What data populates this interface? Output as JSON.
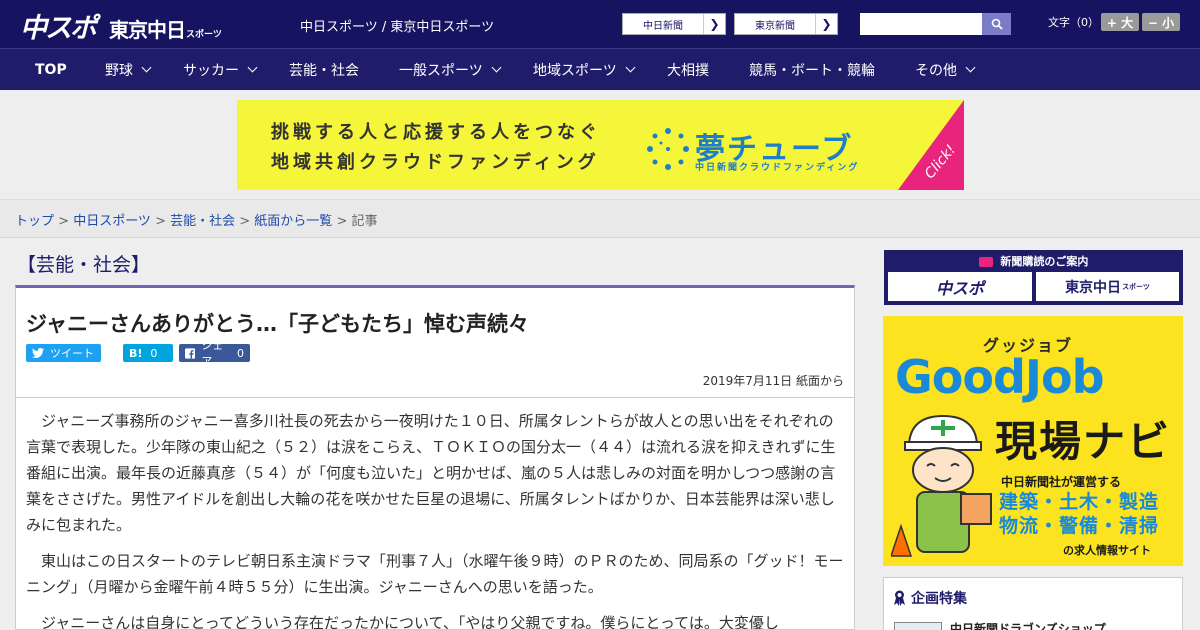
{
  "header": {
    "logo_main": "中スポ",
    "logo_tokyo": "東京中日",
    "logo_tokyo_small": "スポーツ",
    "sites_text": "中日スポーツ / 東京中日スポーツ",
    "site_buttons": [
      {
        "label": "中日新聞"
      },
      {
        "label": "東京新聞"
      }
    ],
    "search_placeholder": "",
    "font_label": "文字（0）",
    "font_plus": "+ 大",
    "font_minus": "− 小"
  },
  "nav": {
    "items": [
      {
        "label": "TOP"
      },
      {
        "label": "野球"
      },
      {
        "label": "サッカー"
      },
      {
        "label": "芸能・社会"
      },
      {
        "label": "一般スポーツ"
      },
      {
        "label": "地域スポーツ"
      },
      {
        "label": "大相撲"
      },
      {
        "label": "競馬・ボート・競輪"
      },
      {
        "label": "その他"
      }
    ]
  },
  "banner": {
    "line1": "挑戦する人と応援する人をつなぐ",
    "line2": "地域共創クラウドファンディング",
    "brand": "夢チューブ",
    "brand_sub": "中日新聞クラウドファンディング",
    "click": "Click!"
  },
  "breadcrumb": {
    "items": [
      "トップ",
      "中日スポーツ",
      "芸能・社会",
      "紙面から一覧"
    ],
    "current": "記事"
  },
  "article": {
    "category": "【芸能・社会】",
    "title": "ジャニーさんありがとう…「子どもたち」悼む声続々",
    "tweet_label": "ツイート",
    "hatena_label": "B!",
    "hatena_count": "0",
    "fb_label": "シェア",
    "fb_count": "0",
    "date": "2019年7月11日 紙面から",
    "paragraphs": [
      "ジャニーズ事務所のジャニー喜多川社長の死去から一夜明けた１０日、所属タレントらが故人との思い出をそれぞれの言葉で表現した。少年隊の東山紀之（５２）は涙をこらえ、ＴＯＫＩＯの国分太一（４４）は流れる涙を抑えきれずに生番組に出演。最年長の近藤真彦（５４）が「何度も泣いた」と明かせば、嵐の５人は悲しみの対面を明かしつつ感謝の言葉をささげた。男性アイドルを創出し大輪の花を咲かせた巨星の退場に、所属タレントばかりか、日本芸能界は深い悲しみに包まれた。",
      "東山はこの日スタートのテレビ朝日系主演ドラマ「刑事７人」（水曜午後９時）のＰＲのため、同局系の「グッド！モーニング」（月曜から金曜午前４時５５分）に生出演。ジャニーさんへの思いを語った。",
      "ジャニーさんは自身にとってどういう存在だったかについて、「やはり父親ですね。僕らにとっては。大変優し"
    ]
  },
  "sidebar": {
    "subscription_title": "新聞購読のご案内",
    "sub_buttons": [
      {
        "label": "中スポ"
      },
      {
        "label": "東京中日"
      }
    ],
    "sub_tokyo_small": "スポーツ",
    "goodjob_kana": "グッジョブ",
    "goodjob_main": "GoodJob",
    "goodjob_genba": "現場ナビ",
    "goodjob_sub1": "中日新聞社が運営する",
    "goodjob_sub2_line1": "建築・土木・製造",
    "goodjob_sub2_line2": "物流・警備・清掃",
    "goodjob_sub3": "の求人情報サイト",
    "feature_title": "企画特集",
    "feature_item": "中日新聞ドラゴンズショップ"
  },
  "colors": {
    "header_bg": "#161460",
    "nav_bg": "#1f1d6a",
    "accent": "#6b69b5",
    "twitter": "#1da1f2",
    "hatena": "#00a4de",
    "facebook": "#3b5998",
    "banner_yellow": "#f5f53a",
    "goodjob_yellow": "#fbe320"
  }
}
